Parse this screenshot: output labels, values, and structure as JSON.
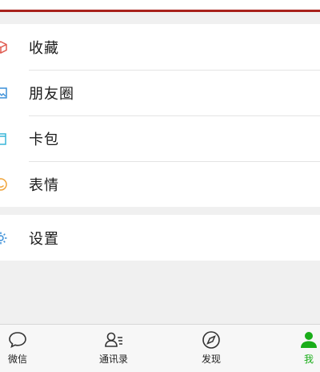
{
  "colors": {
    "accent": "#1aad19",
    "top_line": "#a8221c",
    "favorites_icon": "#e05a4f",
    "moments_icon": "#3a8fd8",
    "cards_icon": "#38b6d8",
    "stickers_icon": "#f0a43a",
    "settings_icon": "#3a8fd8"
  },
  "menu": {
    "items": [
      {
        "label": "收藏",
        "icon": "cube-icon"
      },
      {
        "label": "朋友圈",
        "icon": "photo-icon"
      },
      {
        "label": "卡包",
        "icon": "wallet-icon"
      },
      {
        "label": "表情",
        "icon": "smiley-icon"
      }
    ],
    "settings": {
      "label": "设置",
      "icon": "gear-icon"
    }
  },
  "tabbar": {
    "tabs": [
      {
        "label": "微信",
        "icon": "chat-bubble-icon",
        "active": false
      },
      {
        "label": "通讯录",
        "icon": "contacts-icon",
        "active": false
      },
      {
        "label": "发现",
        "icon": "compass-icon",
        "active": false
      },
      {
        "label": "我",
        "icon": "person-icon",
        "active": true
      }
    ]
  }
}
